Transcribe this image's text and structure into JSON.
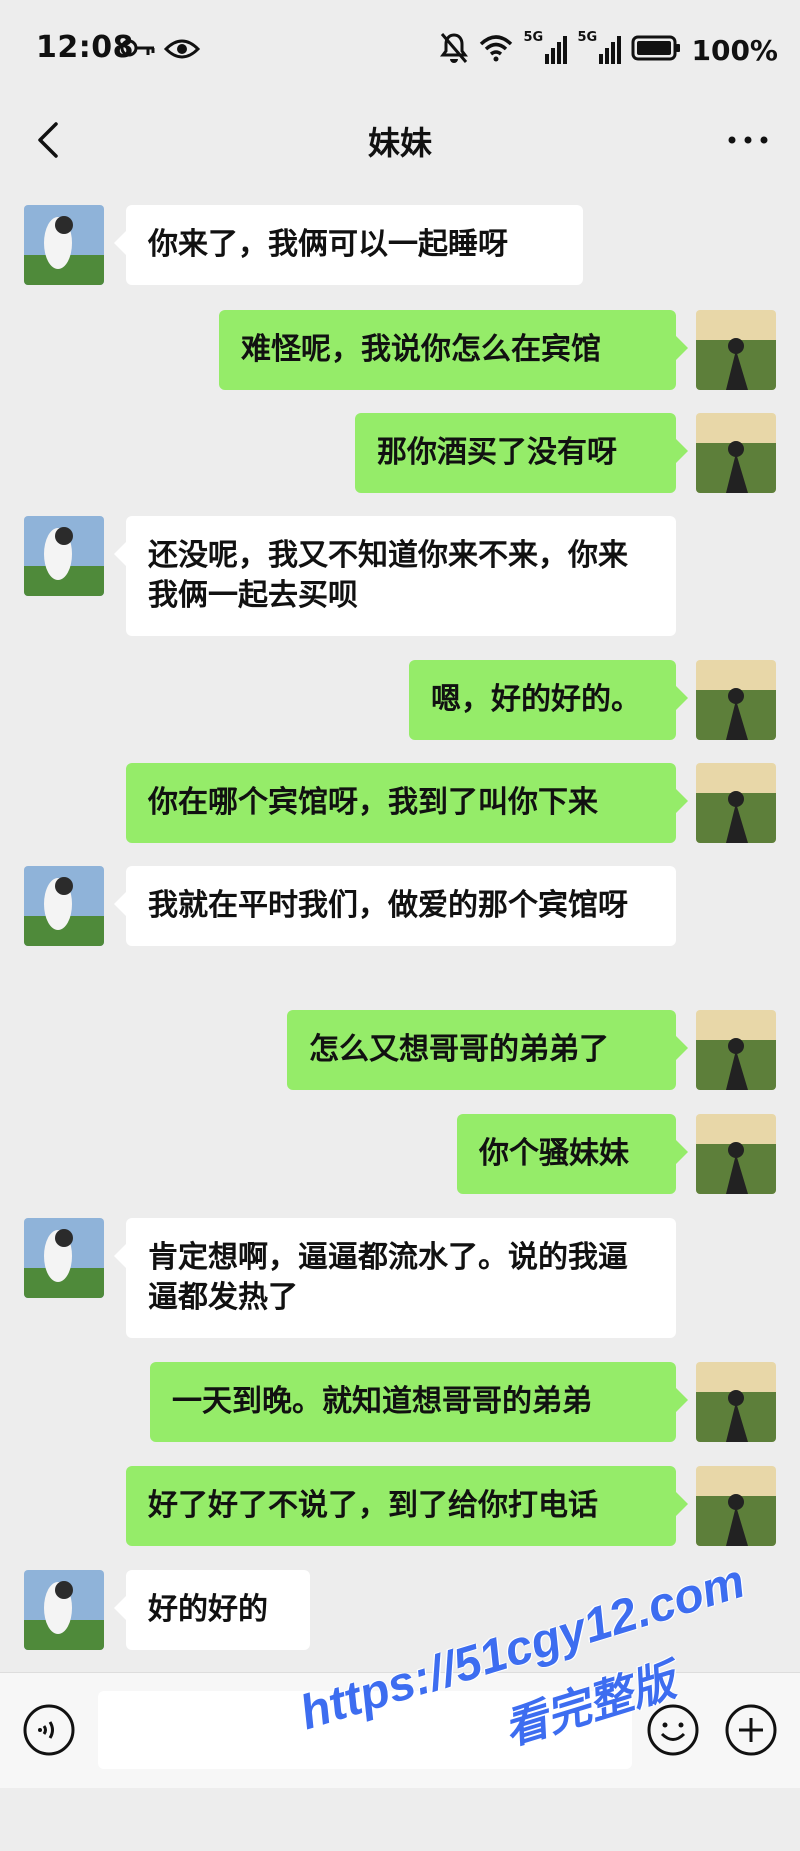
{
  "status_bar": {
    "time": "12:08",
    "battery": "100%",
    "network_labels": [
      "5G",
      "5G"
    ],
    "icons": [
      "key-icon",
      "eye-icon",
      "mute-bell-icon",
      "wifi-icon",
      "signal-icon",
      "signal-icon",
      "battery-icon"
    ]
  },
  "header": {
    "title": "妹妹",
    "back_icon": "back-chevron-icon",
    "more_icon": "more-dots-icon"
  },
  "colors": {
    "background": "#ededed",
    "sent_bubble": "#95ec69",
    "received_bubble": "#ffffff",
    "watermark": "#3d6df0"
  },
  "messages": [
    {
      "side": "left",
      "text": "你来了，我俩可以一起睡呀"
    },
    {
      "side": "right",
      "text": "难怪呢，我说你怎么在宾馆"
    },
    {
      "side": "right",
      "text": "那你酒买了没有呀"
    },
    {
      "side": "left",
      "text": "还没呢，我又不知道你来不来，你来我俩一起去买呗"
    },
    {
      "side": "right",
      "text": "嗯，好的好的。"
    },
    {
      "side": "right",
      "text": "你在哪个宾馆呀，我到了叫你下来"
    },
    {
      "side": "left",
      "text": "我就在平时我们，做爱的那个宾馆呀"
    },
    {
      "side": "right",
      "text": "怎么又想哥哥的弟弟了"
    },
    {
      "side": "right",
      "text": "你个骚妹妹"
    },
    {
      "side": "left",
      "text": "肯定想啊，逼逼都流水了。说的我逼逼都发热了"
    },
    {
      "side": "right",
      "text": "一天到晚。就知道想哥哥的弟弟"
    },
    {
      "side": "right",
      "text": "好了好了不说了，到了给你打电话"
    },
    {
      "side": "left",
      "text": "好的好的"
    }
  ],
  "input_bar": {
    "voice_icon": "voice-icon",
    "emoji_icon": "emoji-icon",
    "plus_icon": "plus-icon"
  },
  "watermark": {
    "line1": "https://51cgy12.com",
    "line2": "看完整版"
  }
}
